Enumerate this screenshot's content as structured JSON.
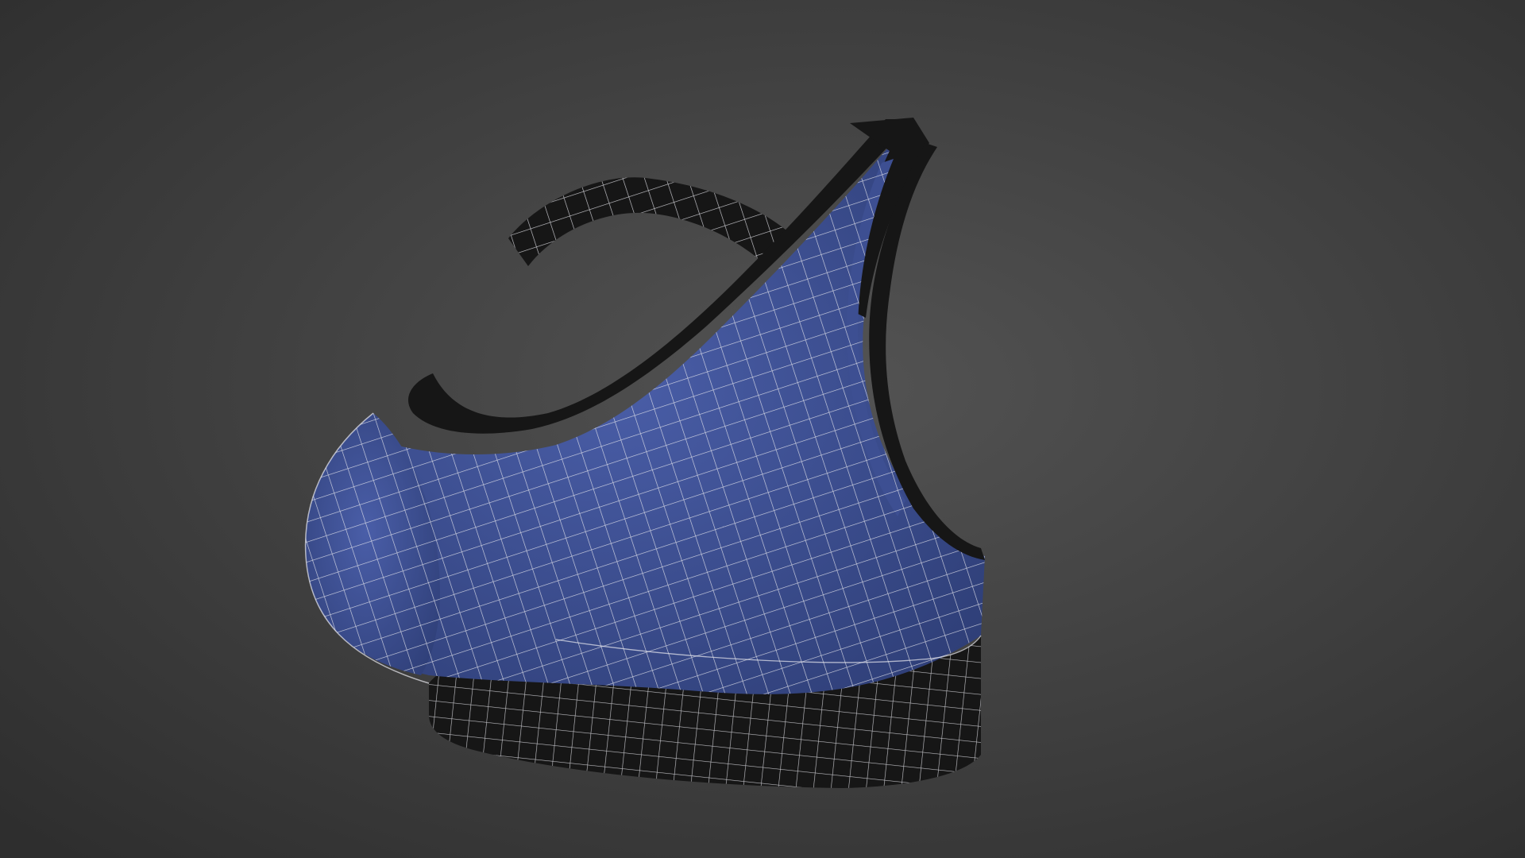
{
  "scene": {
    "background_center": "#535353",
    "background_edge": "#2e2e2e",
    "model": {
      "subject": "sports-bra",
      "fabric_color": "#2f3f78",
      "fabric_highlight": "#4a5ea8",
      "trim_color": "#161616",
      "wire_color": "#e9e9ef"
    }
  }
}
